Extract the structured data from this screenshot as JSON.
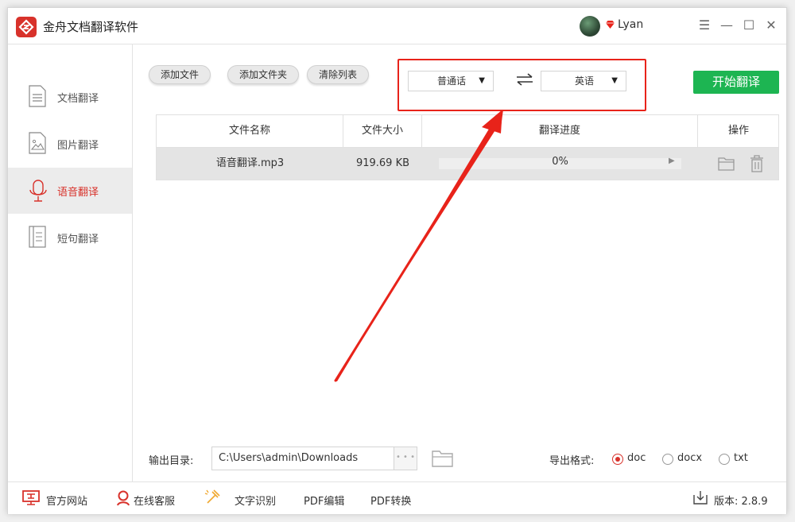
{
  "app": {
    "title": "金舟文档翻译软件",
    "username": "Lyan"
  },
  "window_controls": {
    "menu": "☰",
    "minimize": "—",
    "maximize": "☐",
    "close": "✕"
  },
  "sidebar": {
    "items": [
      {
        "label": "文档翻译",
        "icon": "document-icon",
        "active": false
      },
      {
        "label": "图片翻译",
        "icon": "image-icon",
        "active": false
      },
      {
        "label": "语音翻译",
        "icon": "microphone-icon",
        "active": true
      },
      {
        "label": "短句翻译",
        "icon": "notebook-icon",
        "active": false
      }
    ]
  },
  "toolbar": {
    "add_file": "添加文件",
    "add_folder": "添加文件夹",
    "clear_list": "清除列表",
    "source_lang": "普通话",
    "target_lang": "英语",
    "start": "开始翻译"
  },
  "table": {
    "headers": {
      "name": "文件名称",
      "size": "文件大小",
      "progress": "翻译进度",
      "actions": "操作"
    },
    "rows": [
      {
        "name": "语音翻译.mp3",
        "size": "919.69 KB",
        "progress_text": "0%",
        "progress": 0
      }
    ]
  },
  "output": {
    "label": "输出目录:",
    "path": "C:\\Users\\admin\\Downloads",
    "format_label": "导出格式:",
    "formats": [
      {
        "label": "doc",
        "selected": true
      },
      {
        "label": "docx",
        "selected": false
      },
      {
        "label": "txt",
        "selected": false
      }
    ]
  },
  "statusbar": {
    "website": "官方网站",
    "support": "在线客服",
    "ocr": "文字识别",
    "pdf_edit": "PDF编辑",
    "pdf_convert": "PDF转换",
    "version": "版本: 2.8.9"
  },
  "colors": {
    "brand_red": "#d8322b",
    "start_green": "#1db552",
    "annotation_red": "#e8231a"
  }
}
